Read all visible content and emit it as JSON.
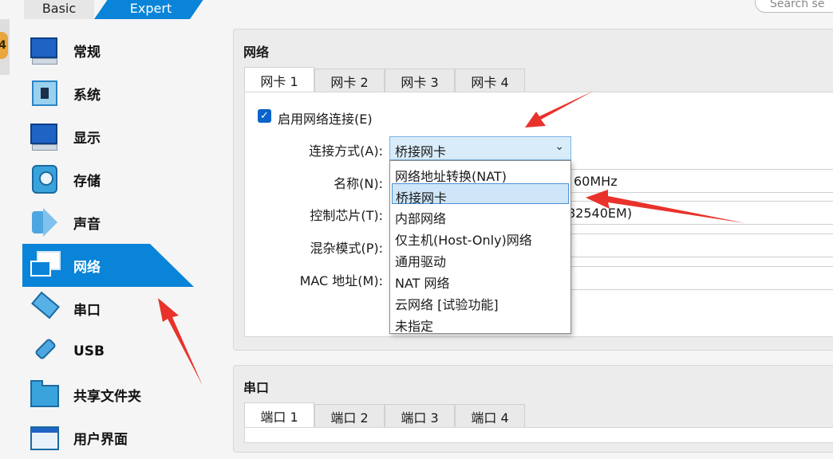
{
  "mode_tabs": {
    "basic": "Basic",
    "expert": "Expert"
  },
  "search": {
    "placeholder": "Search se"
  },
  "left_badge": "4",
  "sidebar": {
    "items": [
      {
        "label": "常规",
        "icon": "general-monitor-icon"
      },
      {
        "label": "系统",
        "icon": "system-chip-icon"
      },
      {
        "label": "显示",
        "icon": "display-monitor-icon"
      },
      {
        "label": "存储",
        "icon": "storage-disk-icon"
      },
      {
        "label": "声音",
        "icon": "audio-speaker-icon"
      },
      {
        "label": "网络",
        "icon": "network-icon",
        "active": true
      },
      {
        "label": "串口",
        "icon": "serial-port-icon"
      },
      {
        "label": "USB",
        "icon": "usb-icon"
      },
      {
        "label": "共享文件夹",
        "icon": "shared-folder-icon"
      },
      {
        "label": "用户界面",
        "icon": "user-interface-icon"
      }
    ]
  },
  "network": {
    "title": "网络",
    "tabs": [
      "网卡 1",
      "网卡 2",
      "网卡 3",
      "网卡 4"
    ],
    "enable_label": "启用网络连接(E)",
    "attached_label": "连接方式(A):",
    "attached_value": "桥接网卡",
    "name_label": "名称(N):",
    "name_value_partial": "60MHz",
    "adapter_label": "控制芯片(T):",
    "adapter_value_partial": "82540EM)",
    "promisc_label": "混杂模式(P):",
    "mac_label": "MAC 地址(M):",
    "dropdown_options": [
      "网络地址转换(NAT)",
      "桥接网卡",
      "内部网络",
      "仅主机(Host-Only)网络",
      "通用驱动",
      "NAT 网络",
      "云网络 [试验功能]",
      "未指定"
    ],
    "selected_index": 1
  },
  "serial": {
    "title": "串口",
    "tabs": [
      "端口 1",
      "端口 2",
      "端口 3",
      "端口 4"
    ]
  },
  "colors": {
    "accent": "#0a84d8",
    "annotation_arrow": "#e8322b"
  }
}
